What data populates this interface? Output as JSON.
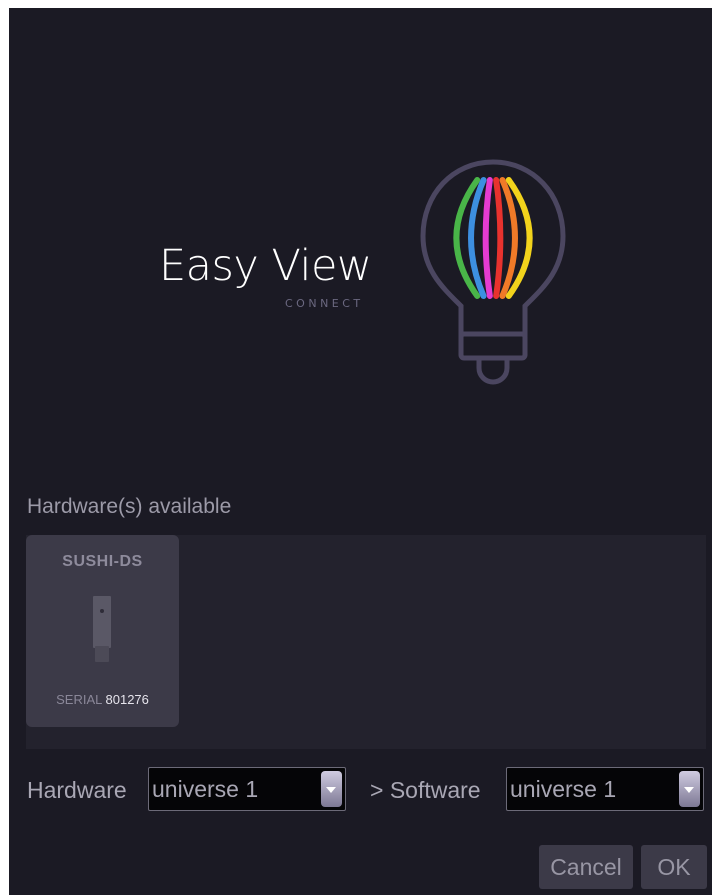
{
  "brand": {
    "title": "Easy View",
    "subtitle": "CONNECT",
    "icon": "lightbulb-logo-icon",
    "stripe_colors": [
      "#49b548",
      "#3d8fe0",
      "#e53bd1",
      "#e8322e",
      "#f07a28",
      "#f2d31c"
    ]
  },
  "hardware": {
    "section_label": "Hardware(s) available",
    "devices": [
      {
        "name": "SUSHI-DS",
        "serial_label": "SERIAL",
        "serial": "801276",
        "icon": "usb-dongle-icon"
      }
    ]
  },
  "routing": {
    "hardware_label": "Hardware",
    "hardware_universe": "universe 1",
    "software_label": "> Software",
    "software_universe": "universe 1"
  },
  "buttons": {
    "cancel": "Cancel",
    "ok": "OK"
  }
}
